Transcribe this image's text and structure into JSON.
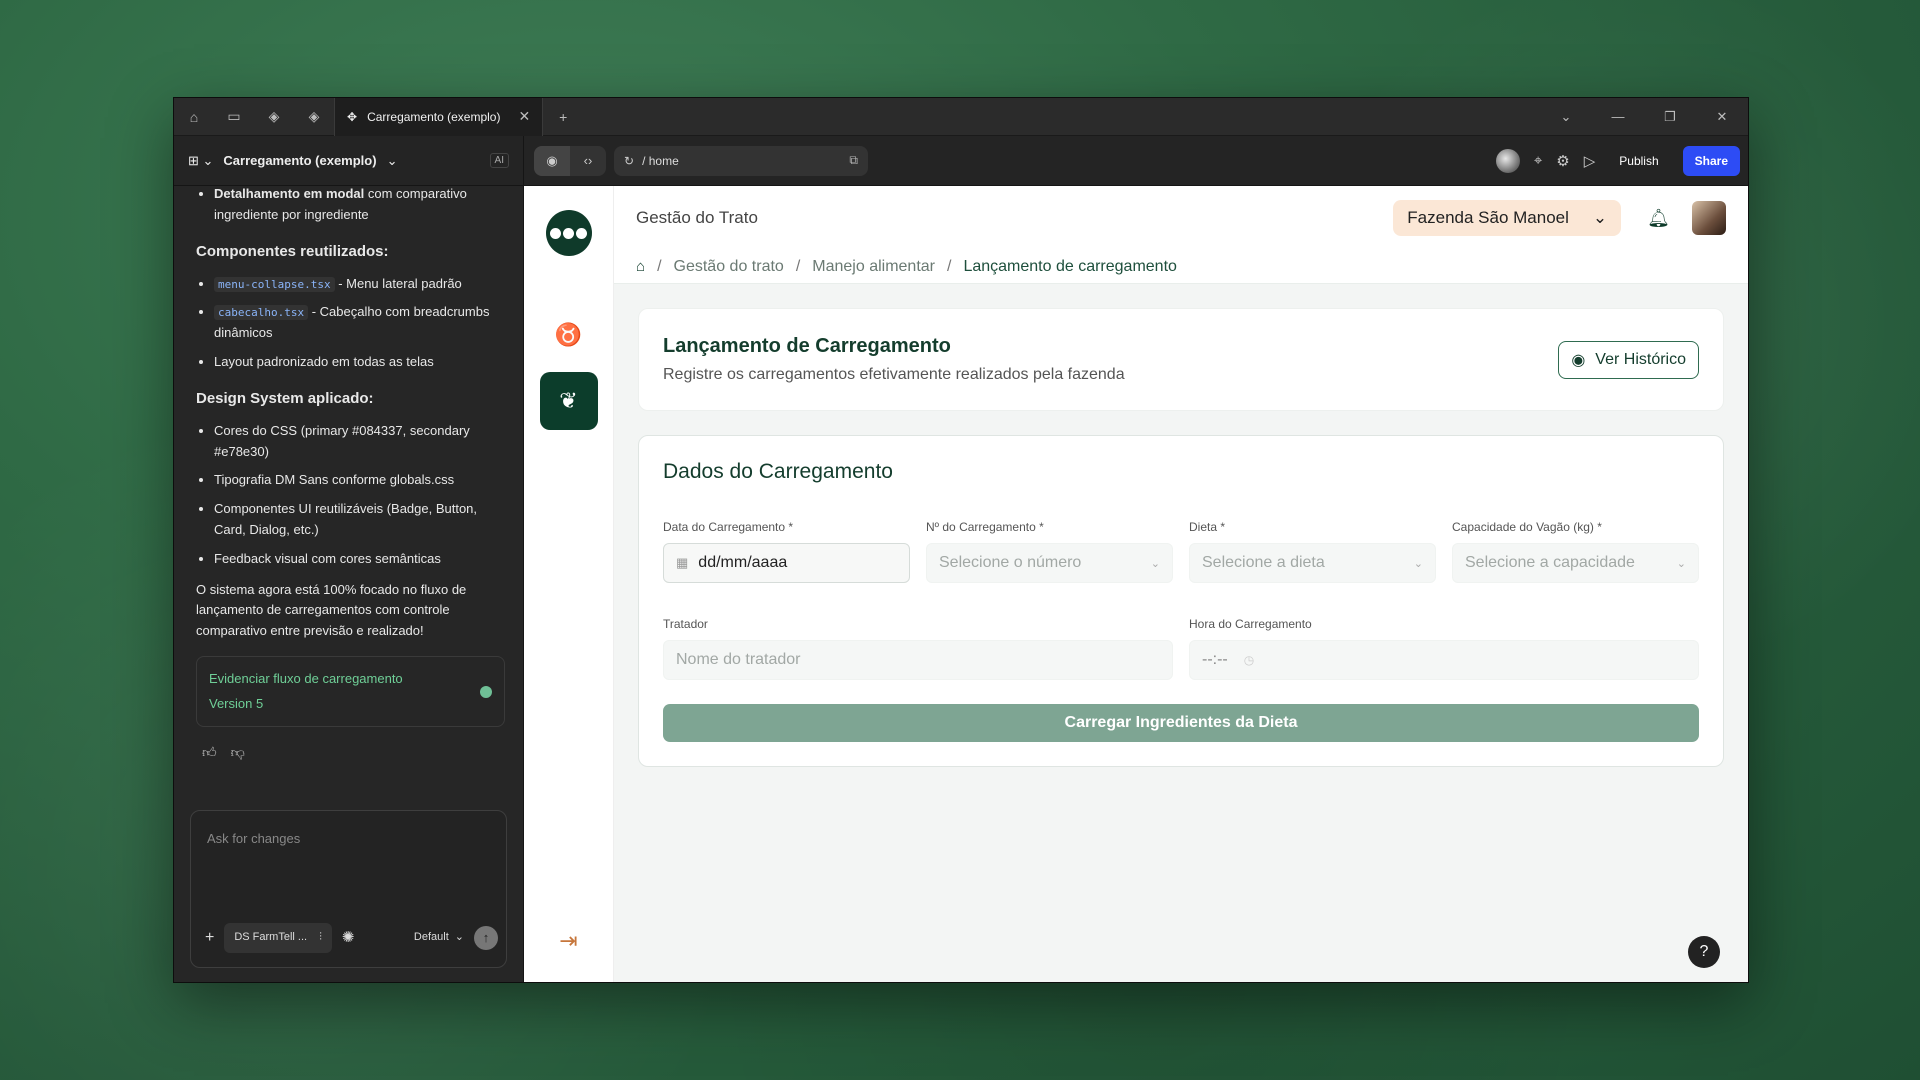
{
  "titlebar": {
    "active_tab": "Carregamento (exemplo)",
    "icons": [
      "home-icon",
      "book-icon",
      "tag-icon",
      "tag-icon"
    ]
  },
  "toolbar": {
    "project": "Carregamento (exemplo)",
    "ai_label": "AI",
    "url": "/ home",
    "publish": "Publish",
    "share": "Share"
  },
  "chat": {
    "intro_bold": "Detalhamento em modal",
    "intro_rest": " com comparativo ingrediente por ingrediente",
    "heading_components": "Componentes reutilizados:",
    "components": [
      {
        "code": "menu-collapse.tsx",
        "text": " - Menu lateral padrão"
      },
      {
        "code": "cabecalho.tsx",
        "text": " - Cabeçalho com breadcrumbs dinâmicos"
      },
      {
        "code": "",
        "text": "Layout padronizado em todas as telas"
      }
    ],
    "heading_design": "Design System aplicado:",
    "design_items": [
      "Cores do CSS (primary #084337, secondary #e78e30)",
      "Tipografia DM Sans conforme globals.css",
      "Componentes UI reutilizáveis (Badge, Button, Card, Dialog, etc.)",
      "Feedback visual com cores semânticas"
    ],
    "summary": "O sistema agora está 100% focado no fluxo de lançamento de carregamentos com controle comparativo entre previsão e realizado!",
    "version_title": "Evidenciar fluxo de carregamento",
    "version_label": "Version 5",
    "composer_placeholder": "Ask for changes",
    "ds_chip": "DS FarmTell ...",
    "mode": "Default"
  },
  "app": {
    "header_title": "Gestão do Trato",
    "farm": "Fazenda São Manoel",
    "breadcrumb": [
      "Gestão do trato",
      "Manejo alimentar",
      "Lançamento de carregamento"
    ],
    "page_title": "Lançamento de Carregamento",
    "page_subtitle": "Registre os carregamentos efetivamente realizados pela fazenda",
    "history_button": "Ver Histórico",
    "form_title": "Dados do Carregamento",
    "fields": {
      "date_label": "Data do Carregamento *",
      "date_value": "dd/mm/aaaa",
      "number_label": "Nº do Carregamento *",
      "number_placeholder": "Selecione o número",
      "diet_label": "Dieta *",
      "diet_placeholder": "Selecione a dieta",
      "capacity_label": "Capacidade do Vagão (kg) *",
      "capacity_placeholder": "Selecione a capacidade",
      "handler_label": "Tratador",
      "handler_placeholder": "Nome do tratador",
      "time_label": "Hora do Carregamento",
      "time_value": "--:--"
    },
    "submit": "Carregar Ingredientes da Dieta",
    "help": "?"
  },
  "colors": {
    "primary": "#084337",
    "share_blue": "#2d4cf5",
    "farm_bg": "#fbe7d6",
    "submit_bg": "#7ea593"
  }
}
